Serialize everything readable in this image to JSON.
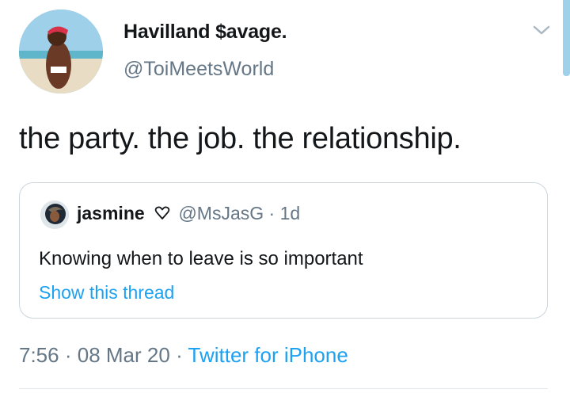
{
  "author": {
    "display_name": "Havilland $avage.",
    "handle": "@ToiMeetsWorld"
  },
  "tweet": {
    "text": "the party. the job. the relationship."
  },
  "quoted_tweet": {
    "name": "jasmine",
    "handle": "@MsJasG",
    "dot": "·",
    "time": "1d",
    "text": "Knowing when to leave is so important",
    "thread_link": "Show this thread"
  },
  "meta": {
    "time": "7:56",
    "dot1": "·",
    "date": "08 Mar 20",
    "dot2": "·",
    "source": "Twitter for iPhone"
  },
  "colors": {
    "link": "#1da1f2",
    "secondary_text": "#657786",
    "primary_text": "#14171a",
    "border": "#ccd6dd"
  },
  "icons": {
    "menu": "chevron-down-icon",
    "verified_heart": "heart-outline-icon"
  }
}
